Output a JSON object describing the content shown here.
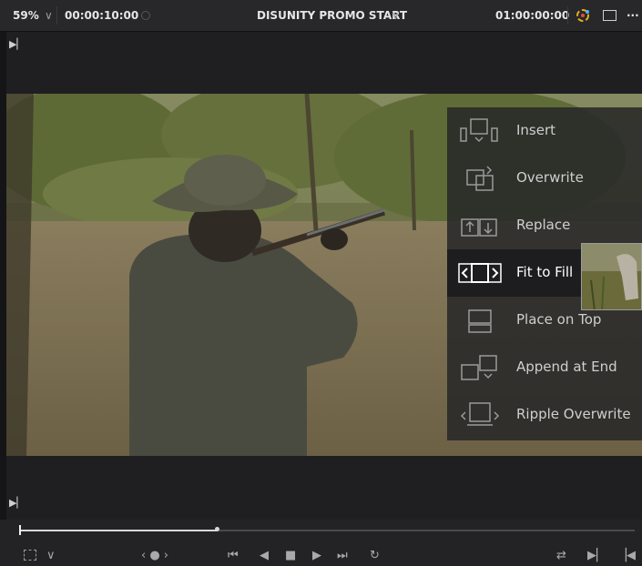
{
  "topbar": {
    "zoom": "59%",
    "zoom_caret": "∨",
    "timecode_left": "00:00:10:00",
    "title": "DISUNITY PROMO START",
    "title_caret": "∨",
    "timecode_right": "01:00:00:00",
    "more": "···"
  },
  "viewer": {
    "in_mark": "▶▏",
    "out_mark": "▶▏"
  },
  "edit_overlay": {
    "items": [
      {
        "label": "Insert",
        "icon": "insert-icon"
      },
      {
        "label": "Overwrite",
        "icon": "overwrite-icon"
      },
      {
        "label": "Replace",
        "icon": "replace-icon"
      },
      {
        "label": "Fit to Fill",
        "icon": "fit-to-fill-icon"
      },
      {
        "label": "Place on Top",
        "icon": "place-on-top-icon"
      },
      {
        "label": "Append at End",
        "icon": "append-at-end-icon"
      },
      {
        "label": "Ripple Overwrite",
        "icon": "ripple-overwrite-icon"
      }
    ],
    "selected": "Fit to Fill"
  },
  "transport": {
    "scrubber_position": 0.32,
    "clip_caret": "∨",
    "jog": "‹ ● ›",
    "prev_clip": "⏮",
    "reverse": "◀",
    "stop": "■",
    "play": "▶",
    "next_clip": "⏭",
    "loop": "↻",
    "match_frame": "⇄",
    "mark_in": "▶▏",
    "mark_out": "▕◀"
  },
  "colors": {
    "overlay_bg": "#262628",
    "selected_bg": "#1d1d1f",
    "accent_red": "#e84b3c"
  }
}
